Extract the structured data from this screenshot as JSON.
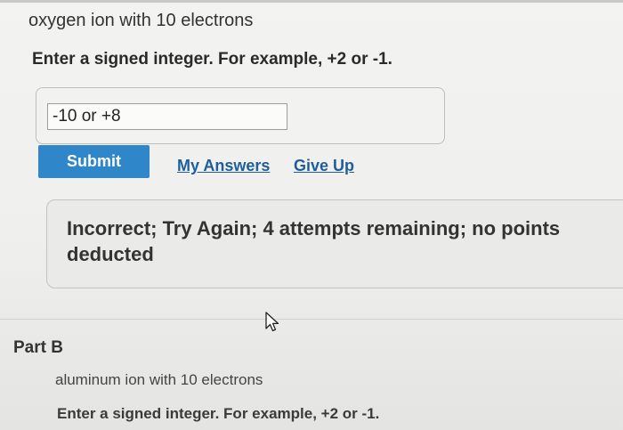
{
  "part_a": {
    "prompt": "oxygen ion with 10 electrons",
    "instruction": "Enter a signed integer. For example, +2 or -1.",
    "answer_value": "-10 or +8",
    "submit_label": "Submit",
    "my_answers_label": "My Answers",
    "give_up_label": "Give Up",
    "feedback": "Incorrect; Try Again; 4 attempts remaining; no points deducted"
  },
  "part_b": {
    "label": "Part B",
    "prompt": "aluminum ion with 10 electrons",
    "instruction": "Enter a signed integer. For example, +2 or -1."
  },
  "icons": {
    "cursor": "mouse-pointer-icon"
  },
  "colors": {
    "submit_button": "#2f86c9",
    "link": "#1f5e99"
  }
}
